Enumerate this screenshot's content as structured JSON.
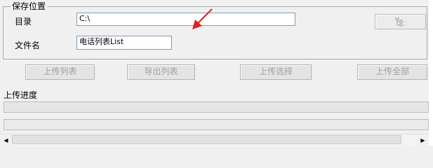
{
  "save_location": {
    "group_label": "保存位置",
    "directory_label": "目录",
    "directory_value": "C:\\",
    "filename_label": "文件名",
    "filename_value": "电话列表List",
    "browse_icon": "folder-tree-icon"
  },
  "buttons": {
    "upload_list": "上传列表",
    "export_list": "导出列表",
    "upload_selected": "上传选择",
    "upload_all": "上传全部"
  },
  "progress": {
    "label": "上传进度",
    "value": 0
  },
  "colors": {
    "annotation_arrow": "#e02020",
    "textbox_border": "#7f9db9",
    "disabled_text": "#a0a0a0"
  },
  "annotation": {
    "icon": "red-arrow-icon"
  }
}
